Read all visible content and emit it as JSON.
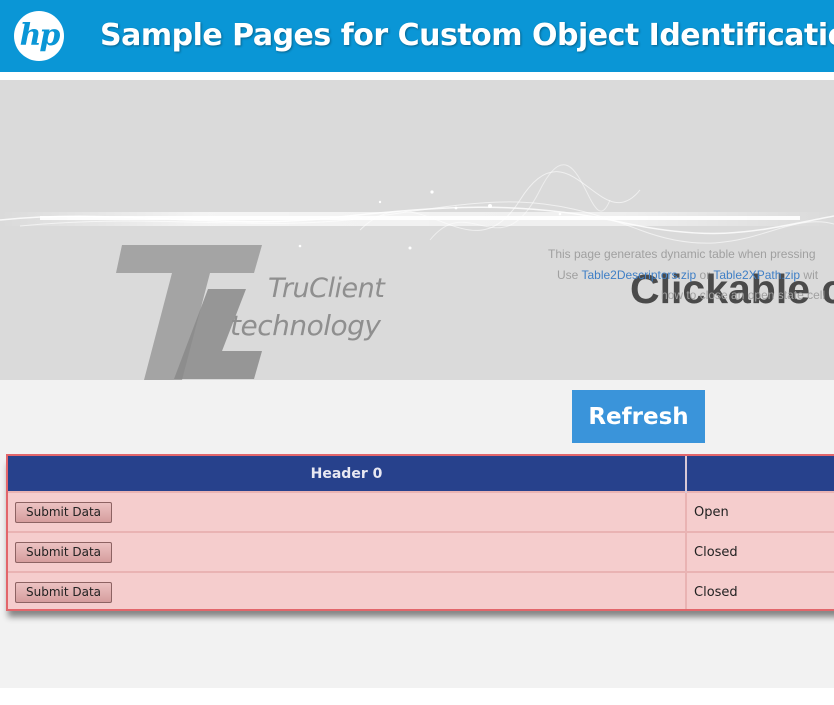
{
  "header": {
    "logo_text": "hp",
    "title": "Sample Pages for Custom Object Identification",
    "background": "#0a96d6"
  },
  "banner": {
    "brand_line1": "TruClient",
    "brand_line2": "technology",
    "title": "Clickable ce",
    "desc_line1": "This page generates dynamic table when pressing",
    "desc_line2_prefix": "Use",
    "link1": "Table2Descriptors.zip",
    "desc_line2_mid": "or",
    "link2": "Table2XPath.zip",
    "desc_line2_suffix": "wit",
    "desc_line3": "how to close an open state cell",
    "link_color": "#3f7fc6"
  },
  "refresh_button": {
    "label": "Refresh",
    "color": "#3a94da"
  },
  "table": {
    "headers": [
      "Header 0",
      ""
    ],
    "header_color": "#27418c",
    "row_color": "#f5cdcd",
    "rows": [
      {
        "button": "Submit Data",
        "status": "Open"
      },
      {
        "button": "Submit Data",
        "status": "Closed"
      },
      {
        "button": "Submit Data",
        "status": "Closed"
      }
    ]
  }
}
